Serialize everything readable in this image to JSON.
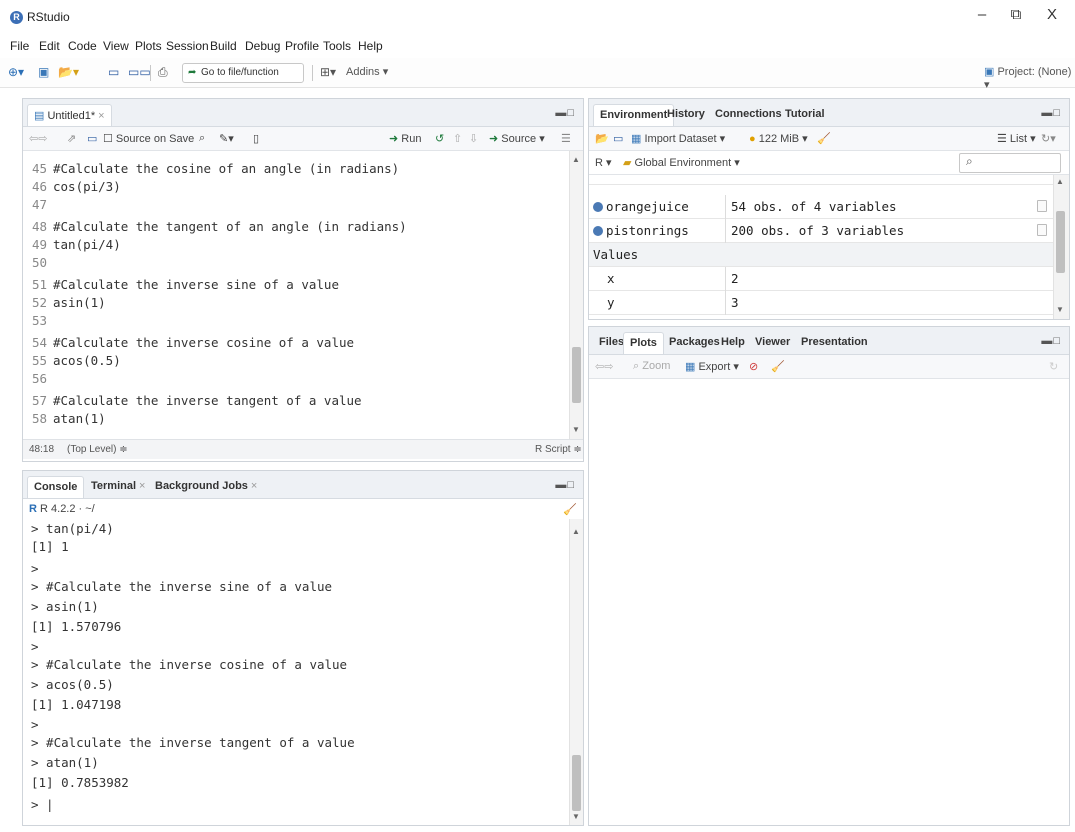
{
  "window": {
    "title": "RStudio",
    "controls": [
      "–",
      "⧉",
      "X"
    ]
  },
  "menu": [
    "File",
    "Edit",
    "Code",
    "View",
    "Plots",
    "Session",
    "Build",
    "Debug",
    "Profile",
    "Tools",
    "Help"
  ],
  "toolbar": {
    "goto_label": "Go to file/function",
    "addins_label": "Addins",
    "project_label": "Project: (None)"
  },
  "source": {
    "tab_label": "Untitled1*",
    "source_on_save": "Source on Save",
    "run_label": "Run",
    "source_label": "Source",
    "lines": [
      {
        "n": "45",
        "text": "#Calculate the cosine of an angle (in radians)"
      },
      {
        "n": "46",
        "text": "cos(pi/3)"
      },
      {
        "n": "47",
        "text": ""
      },
      {
        "n": "48",
        "text": "#Calculate the tangent of an angle (in radians)"
      },
      {
        "n": "49",
        "text": "tan(pi/4)"
      },
      {
        "n": "50",
        "text": ""
      },
      {
        "n": "51",
        "text": "#Calculate the inverse sine of a value"
      },
      {
        "n": "52",
        "text": "asin(1)"
      },
      {
        "n": "53",
        "text": ""
      },
      {
        "n": "54",
        "text": "#Calculate the inverse cosine of a value"
      },
      {
        "n": "55",
        "text": "acos(0.5)"
      },
      {
        "n": "56",
        "text": ""
      },
      {
        "n": "57",
        "text": "#Calculate the inverse tangent of a value"
      },
      {
        "n": "58",
        "text": "atan(1)"
      }
    ],
    "status_position": "48:18",
    "status_scope": "(Top Level) ≑",
    "status_type": "R Script ≑"
  },
  "console": {
    "tabs": [
      "Console",
      "Terminal",
      "Background Jobs"
    ],
    "version": "R 4.2.2 · ~/",
    "lines": [
      "> tan(pi/4)",
      "[1] 1",
      ">",
      "> #Calculate the inverse sine of a value",
      "> asin(1)",
      "[1] 1.570796",
      ">",
      "> #Calculate the inverse cosine of a value",
      "> acos(0.5)",
      "[1] 1.047198",
      ">",
      "> #Calculate the inverse tangent of a value",
      "> atan(1)",
      "[1] 0.7853982",
      "> |"
    ]
  },
  "environment": {
    "tabs": [
      "Environment",
      "History",
      "Connections",
      "Tutorial"
    ],
    "import_label": "Import Dataset",
    "memory_label": "122 MiB",
    "list_label": "List",
    "r_label": "R",
    "scope_label": "Global Environment",
    "data_rows": [
      {
        "name": "orangejuice",
        "value": "54 obs. of 4 variables"
      },
      {
        "name": "pistonrings",
        "value": "200 obs. of 3 variables"
      }
    ],
    "values_header": "Values",
    "value_rows": [
      {
        "name": "x",
        "value": "2"
      },
      {
        "name": "y",
        "value": "3"
      }
    ]
  },
  "files": {
    "tabs": [
      "Files",
      "Plots",
      "Packages",
      "Help",
      "Viewer",
      "Presentation"
    ],
    "zoom_label": "Zoom",
    "export_label": "Export"
  }
}
